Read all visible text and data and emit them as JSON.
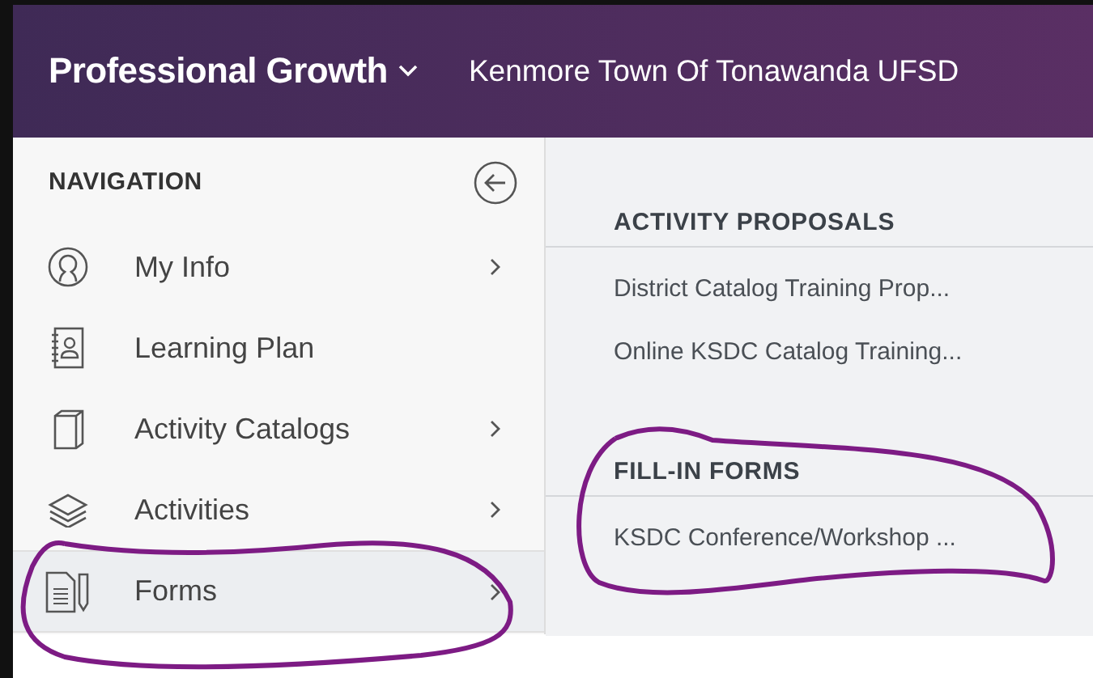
{
  "header": {
    "app_title": "Professional Growth",
    "organization": "Kenmore Town Of Tonawanda UFSD"
  },
  "sidebar": {
    "title": "NAVIGATION",
    "items": [
      {
        "label": "My Info",
        "kind": "user",
        "submenu": true,
        "selected": false
      },
      {
        "label": "Learning Plan",
        "kind": "notebook",
        "submenu": false,
        "selected": false
      },
      {
        "label": "Activity Catalogs",
        "kind": "book",
        "submenu": true,
        "selected": false
      },
      {
        "label": "Activities",
        "kind": "layers",
        "submenu": true,
        "selected": false
      },
      {
        "label": "Forms",
        "kind": "form",
        "submenu": true,
        "selected": true
      }
    ]
  },
  "sections": [
    {
      "title": "ACTIVITY PROPOSALS",
      "items": [
        "District Catalog Training Prop...",
        "Online KSDC Catalog Training..."
      ]
    },
    {
      "title": "FILL-IN FORMS",
      "items": [
        "KSDC Conference/Workshop ..."
      ]
    }
  ]
}
